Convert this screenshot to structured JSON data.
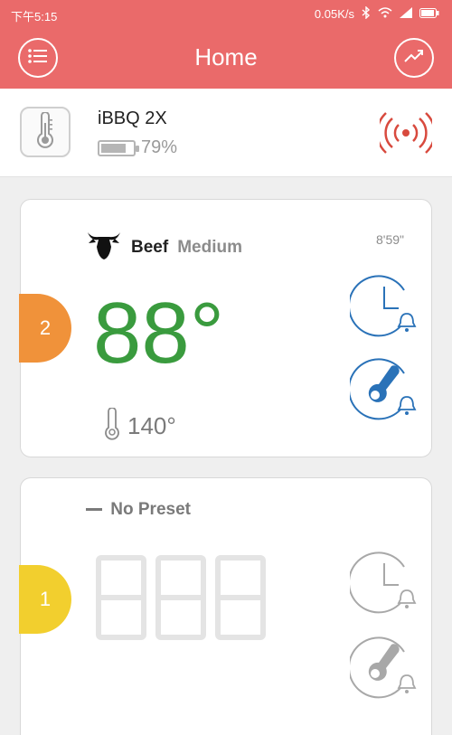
{
  "status_bar": {
    "time": "下午5:15",
    "net_speed": "0.05K/s",
    "icons": [
      "bluetooth-icon",
      "wifi-icon",
      "cell-signal-icon",
      "battery-icon"
    ]
  },
  "app_bar": {
    "title": "Home",
    "left_icon": "menu-list-icon",
    "right_icon": "trend-chart-icon"
  },
  "device": {
    "name": "iBBQ 2X",
    "battery_label": "79%",
    "battery_level": 0.79,
    "icon": "thermometer-icon",
    "signal_icon": "broadcast-icon"
  },
  "probes": [
    {
      "number": "2",
      "color": "#f0923a",
      "meat": "Beef",
      "doneness": "Medium",
      "timer": "8'59\"",
      "current_temp": "88°",
      "target_temp": "140°",
      "icons": [
        "bull-icon",
        "timer-alarm-icon",
        "temperature-alarm-icon"
      ],
      "accent": "#3a9b3e",
      "icon_color": "#2a72b8"
    },
    {
      "number": "1",
      "color": "#f2cf2e",
      "preset_label": "No Preset",
      "current_temp": "888",
      "icon_color": "#a8a8a8"
    }
  ]
}
